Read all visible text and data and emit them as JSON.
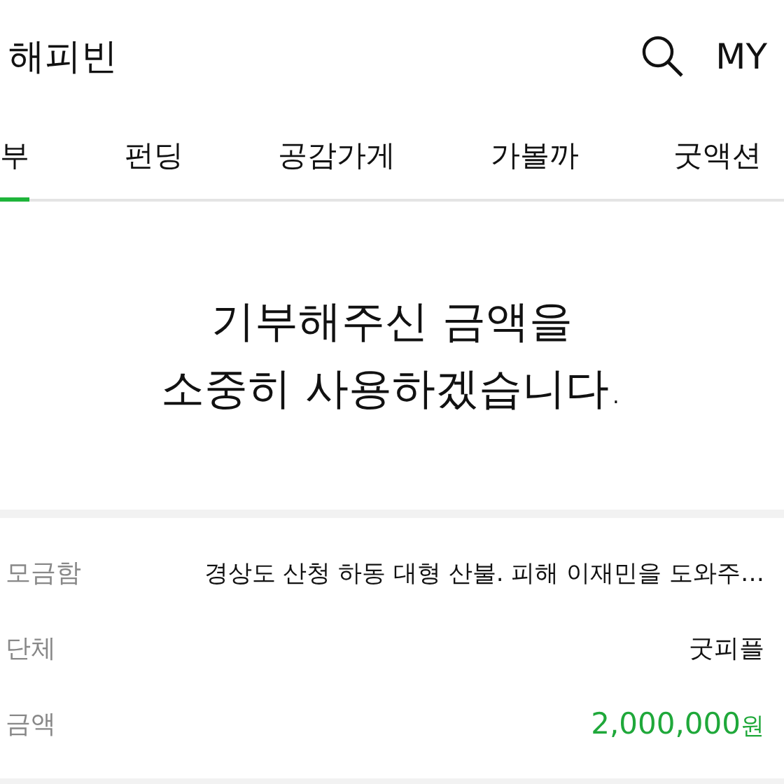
{
  "header": {
    "title": "해피빈",
    "account": "MY"
  },
  "tabs": [
    {
      "label": "부",
      "selected": true
    },
    {
      "label": "펀딩",
      "selected": false
    },
    {
      "label": "공감가게",
      "selected": false
    },
    {
      "label": "가볼까",
      "selected": false
    },
    {
      "label": "굿액션",
      "selected": false
    }
  ],
  "message": [
    "기부해주신 금액을",
    "소중히 사용하겠습니다."
  ],
  "details": [
    {
      "label": "모금함",
      "value": "경상도 산청 하동 대형 산불. 피해 이재민을 도와주…",
      "kind": "text"
    },
    {
      "label": "단체",
      "value": "굿피플",
      "kind": "text"
    },
    {
      "label": "금액",
      "value": "2,000,000",
      "unit": "원",
      "kind": "amount"
    }
  ]
}
